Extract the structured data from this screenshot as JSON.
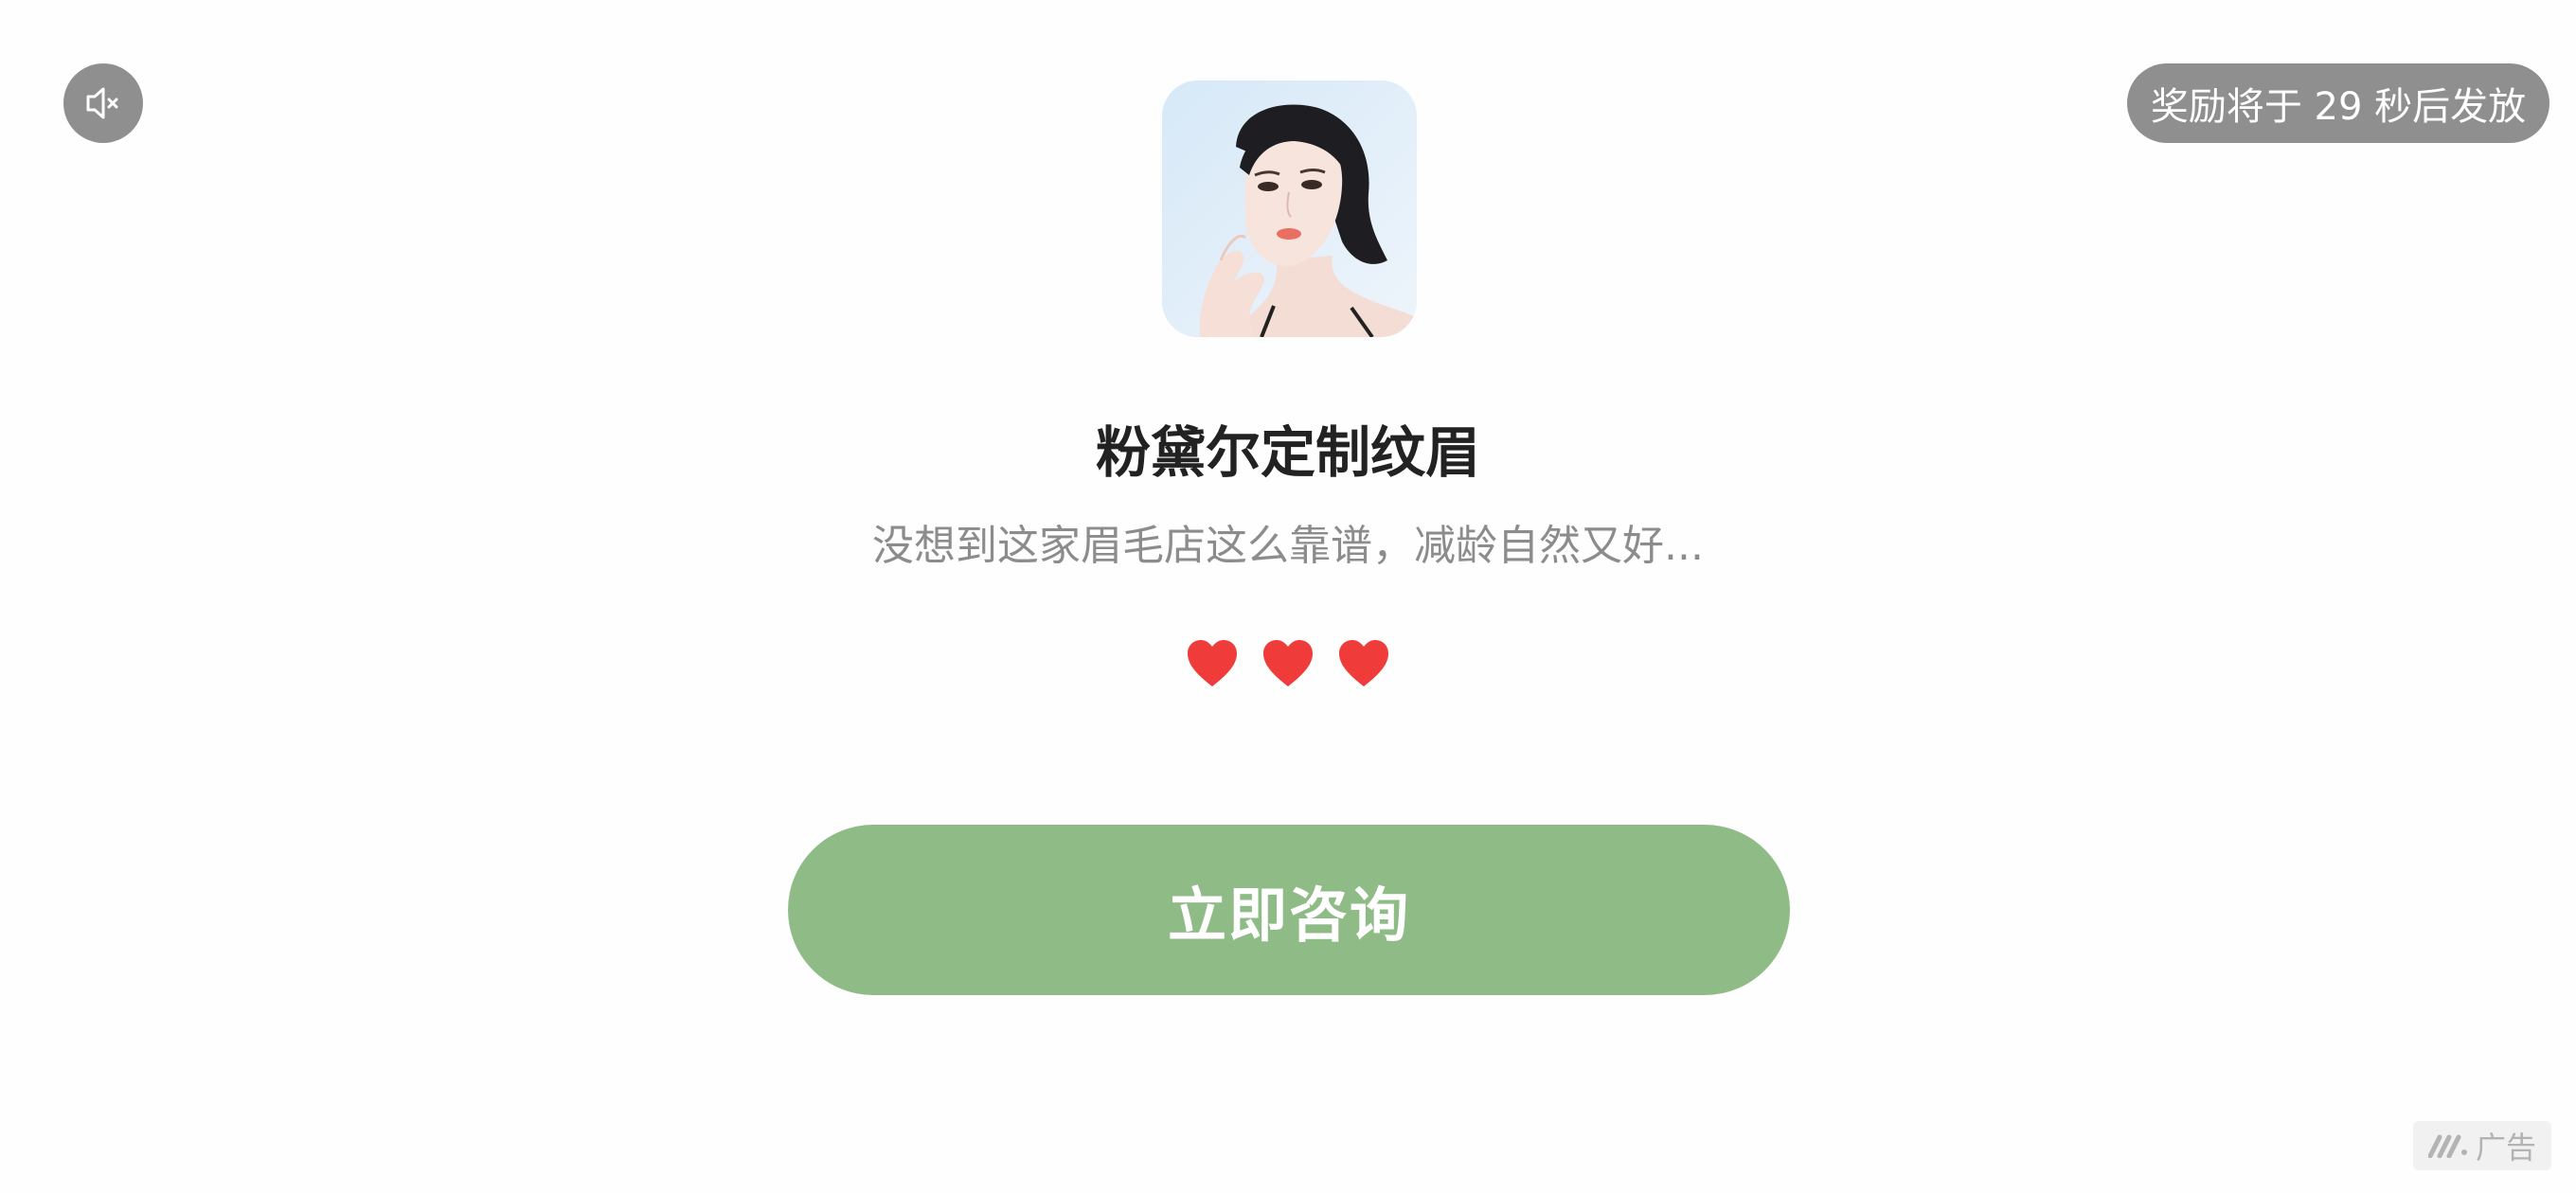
{
  "controls": {
    "mute_icon": "speaker-muted-icon",
    "reward_countdown": "奖励将于 29 秒后发放"
  },
  "ad": {
    "app_icon": "portrait-photo",
    "title": "粉黛尔定制纹眉",
    "description": "没想到这家眉毛店这么靠谱，减龄自然又好...",
    "rating_hearts": 3,
    "cta_label": "立即咨询",
    "badge_label": "广告"
  },
  "colors": {
    "cta_background": "#8fbc86",
    "pill_background": "#8f8f8f",
    "heart": "#f03b3b",
    "title_text": "#222222",
    "description_text": "#8c8c8c"
  }
}
